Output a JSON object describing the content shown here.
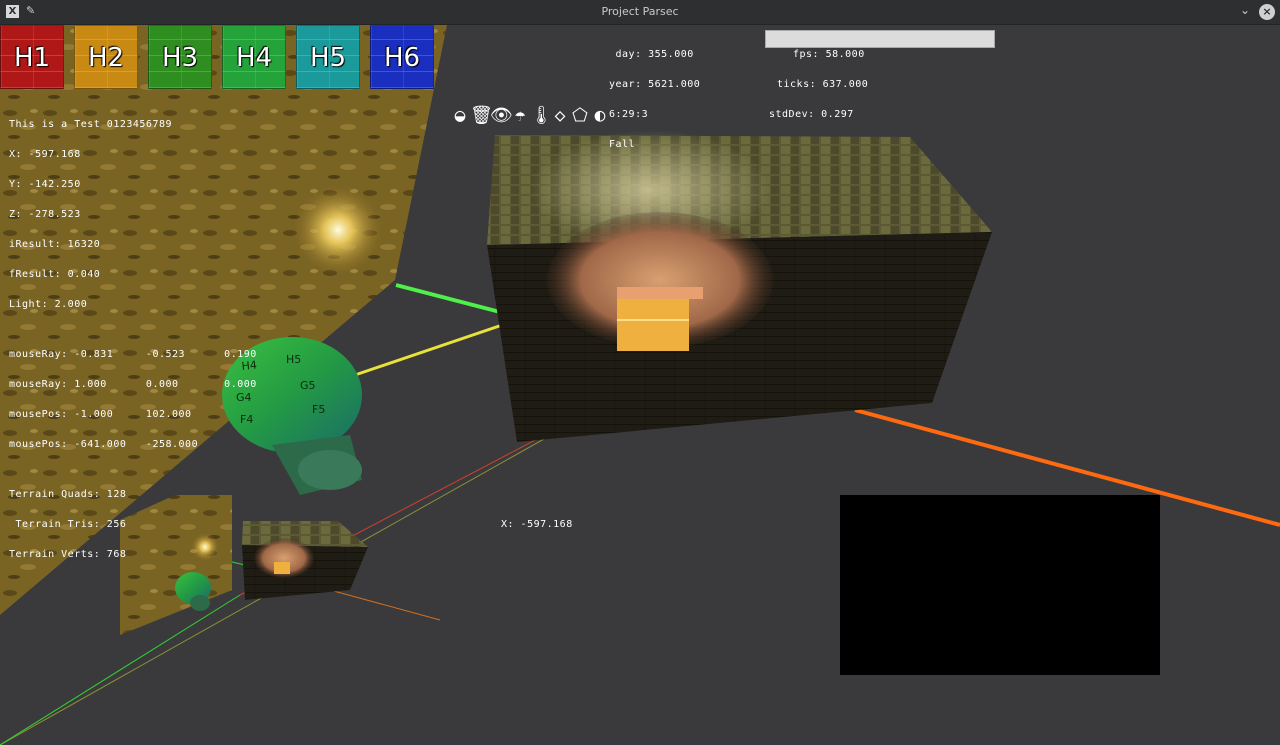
{
  "window": {
    "title": "Project Parsec",
    "app_icon": "X"
  },
  "hotbar": [
    {
      "label": "H1",
      "color": "#b01818"
    },
    {
      "label": "H2",
      "color": "#c98a14"
    },
    {
      "label": "H3",
      "color": "#2e8f20"
    },
    {
      "label": "H4",
      "color": "#23a33a"
    },
    {
      "label": "H5",
      "color": "#1a9a9a"
    },
    {
      "label": "H6",
      "color": "#1a2fc0"
    }
  ],
  "debug_lines": [
    "This is a Test 0123456789",
    "X: -597.168",
    "Y: -142.250",
    "Z: -278.523",
    "iResult: 16320",
    "fResult: 0.040",
    "Light: 2.000",
    "",
    "mouseRay: -0.831     -0.523      0.190",
    "mouseRay: 1.000      0.000       0.000",
    "mousePos: -1.000     102.000",
    "mousePos: -641.000   -258.000",
    "",
    "Terrain Quads: 128",
    " Terrain Tris: 256",
    "Terrain Verts: 768"
  ],
  "time": {
    "day": " day: 355.000",
    "year": "year: 5621.000",
    "clock": "6:29:3",
    "season": "Fall"
  },
  "stats": {
    "fps": "fps: 58.000",
    "ticks": "ticks: 637.000",
    "stddev": "stdDev: 0.297"
  },
  "status_icons": [
    "◒",
    "🗑",
    "👁",
    "☂",
    "🌡",
    "◇",
    "⬠",
    "◐"
  ],
  "cursor_readout": "X: -597.168",
  "colors": {
    "background": "#3a3a3c",
    "terrain": "#7a6424",
    "axis_green": "#4ff04a",
    "axis_yellow": "#e8e23a",
    "axis_orange": "#ff6a10",
    "axis_red": "#e03030"
  }
}
